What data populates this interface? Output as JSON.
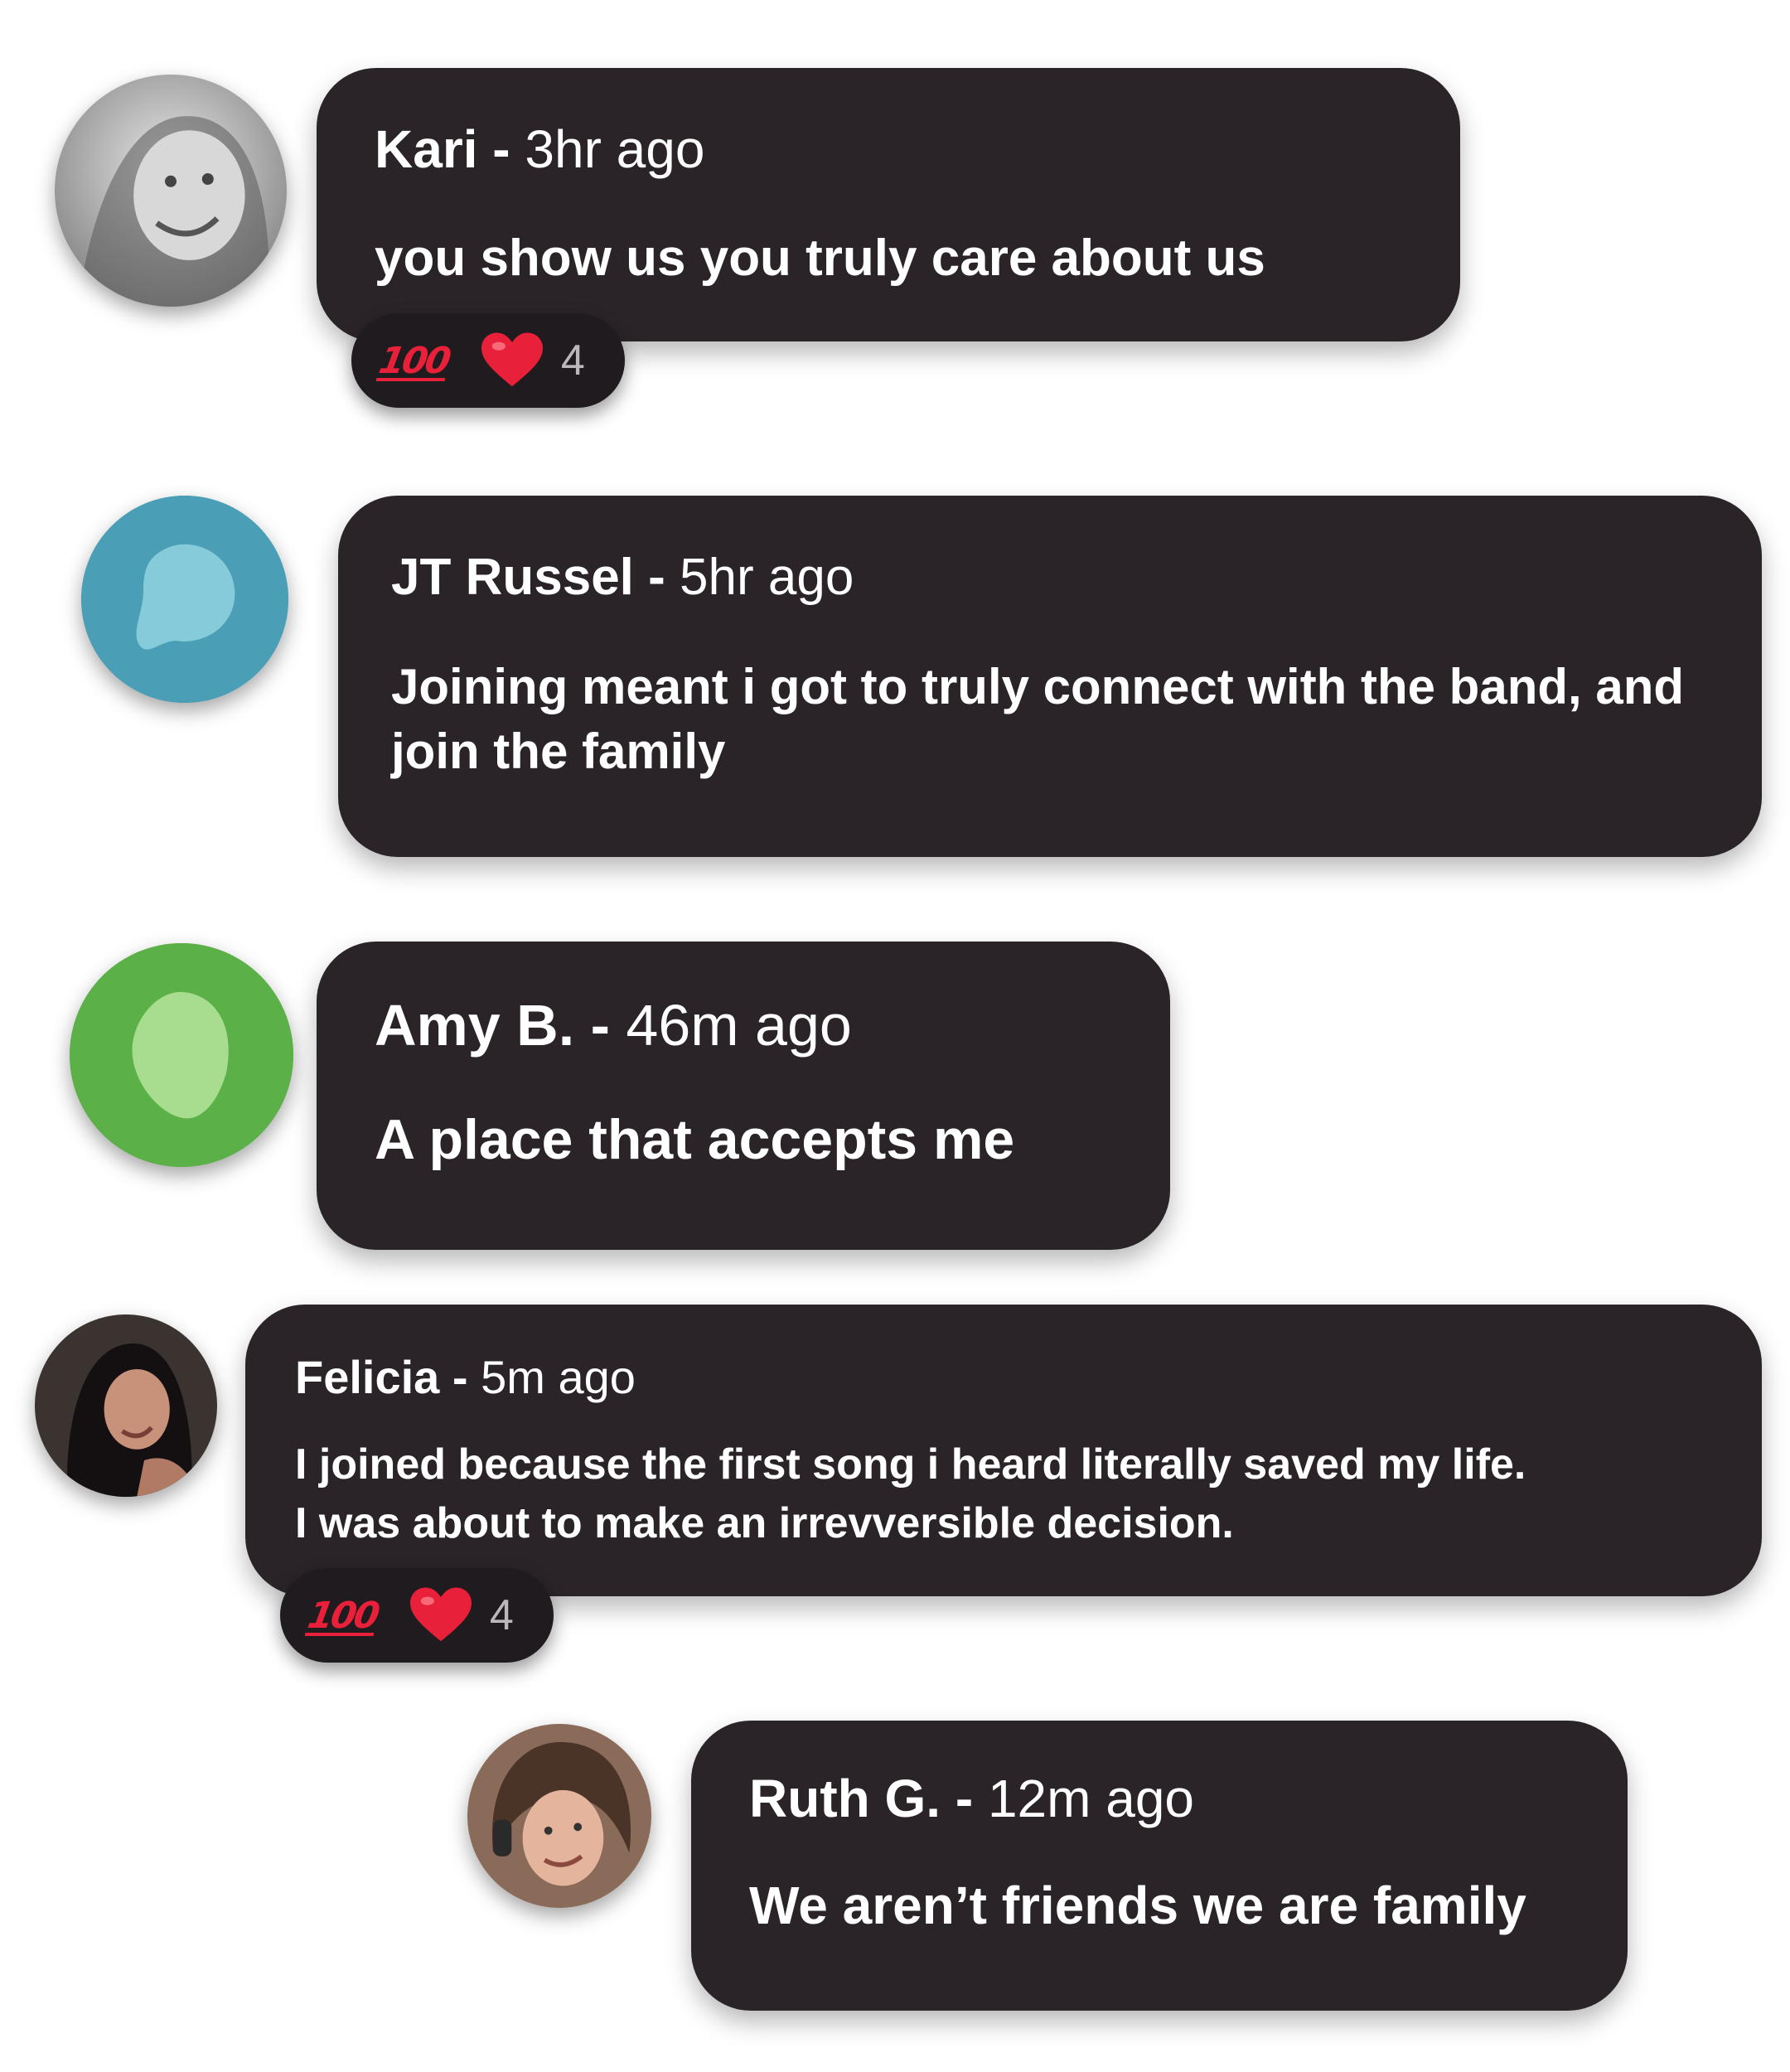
{
  "comments": [
    {
      "name": "Kari",
      "separator": " - ",
      "time": "3hr ago",
      "text": "you show us you truly care about us",
      "avatar": "photo-avatar-grayscale",
      "reactions": {
        "emoji": [
          "100-icon",
          "heart-icon"
        ],
        "count": "4"
      }
    },
    {
      "name": "JT Russel",
      "separator": " - ",
      "time": "5hr ago",
      "text": "Joining meant i got to truly connect with the band, and join the family",
      "avatar": "blob-avatar",
      "avatar_color": "#4a9fb6"
    },
    {
      "name": "Amy B.",
      "separator": " - ",
      "time": "46m ago",
      "text": "A place that accepts me",
      "avatar": "blob-avatar",
      "avatar_color": "#5cb048"
    },
    {
      "name": "Felicia",
      "separator": " - ",
      "time": "5m ago",
      "text_lines": [
        "I joined because the first song i heard literally saved my life.",
        "I was about to make an irrevversible decision."
      ],
      "avatar": "photo-avatar",
      "reactions": {
        "emoji": [
          "100-icon",
          "heart-icon"
        ],
        "count": "4"
      }
    },
    {
      "name": "Ruth G.",
      "separator": " - ",
      "time": "12m ago",
      "text": "We aren’t friends we are family",
      "avatar": "photo-avatar"
    }
  ],
  "reaction_symbols": {
    "hundred": "100"
  },
  "colors": {
    "bubble": "#2a2428",
    "reaction_pill": "#201b1e",
    "heart": "#e8203a",
    "text": "#ffffff"
  }
}
